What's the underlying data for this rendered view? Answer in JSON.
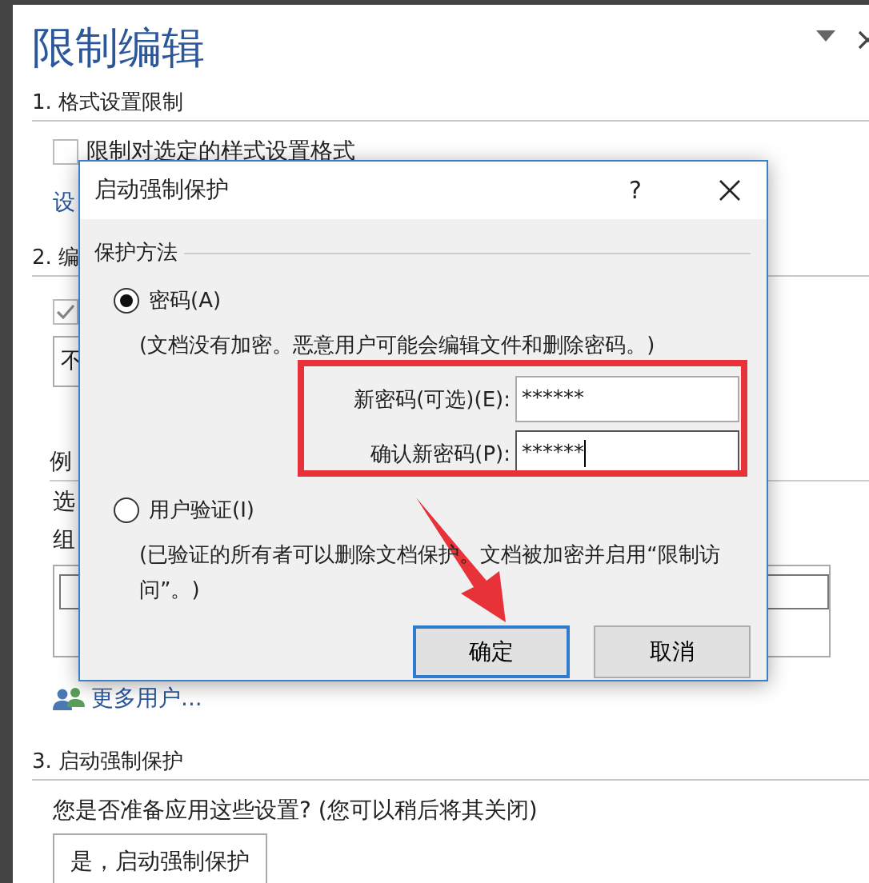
{
  "panel": {
    "title": "限制编辑",
    "sections": [
      {
        "heading": "1. 格式设置限制",
        "items": [
          {
            "kind": "checkbox",
            "label": "限制对选定的样式设置格式",
            "checked": false
          },
          {
            "kind": "link",
            "text": "设"
          }
        ]
      },
      {
        "heading": "2. 编",
        "items": [
          {
            "kind": "checkbox",
            "checked": true
          },
          {
            "kind": "dropdown",
            "value": "不"
          },
          {
            "kind": "subheading",
            "text": "例"
          },
          {
            "kind": "label",
            "text": "选"
          },
          {
            "kind": "label",
            "text": "组"
          },
          {
            "kind": "listbox"
          },
          {
            "kind": "users-link",
            "text": "更多用户..."
          }
        ]
      },
      {
        "heading": "3. 启动强制保护",
        "items": [
          {
            "kind": "text",
            "text": "您是否准备应用这些设置? (您可以稍后将其关闭)"
          },
          {
            "kind": "button",
            "label": "是，启动强制保护"
          }
        ]
      }
    ]
  },
  "dialog": {
    "title": "启动强制保护",
    "help": "?",
    "group": "保护方法",
    "options": [
      {
        "label": "密码(A)",
        "selected": true,
        "note": "(文档没有加密。恶意用户可能会编辑文件和删除密码。)",
        "fields": [
          {
            "label": "新密码(可选)(E):",
            "value": "******",
            "focused": false
          },
          {
            "label": "确认新密码(P):",
            "value": "******",
            "focused": true
          }
        ]
      },
      {
        "label": "用户验证(I)",
        "selected": false,
        "note": "(已验证的所有者可以删除文档保护。文档被加密并启用“限制访问”。)"
      }
    ],
    "buttons": [
      {
        "label": "确定",
        "default": true
      },
      {
        "label": "取消",
        "default": false
      }
    ]
  },
  "annotations": {
    "highlight_box": true,
    "arrow": true
  }
}
